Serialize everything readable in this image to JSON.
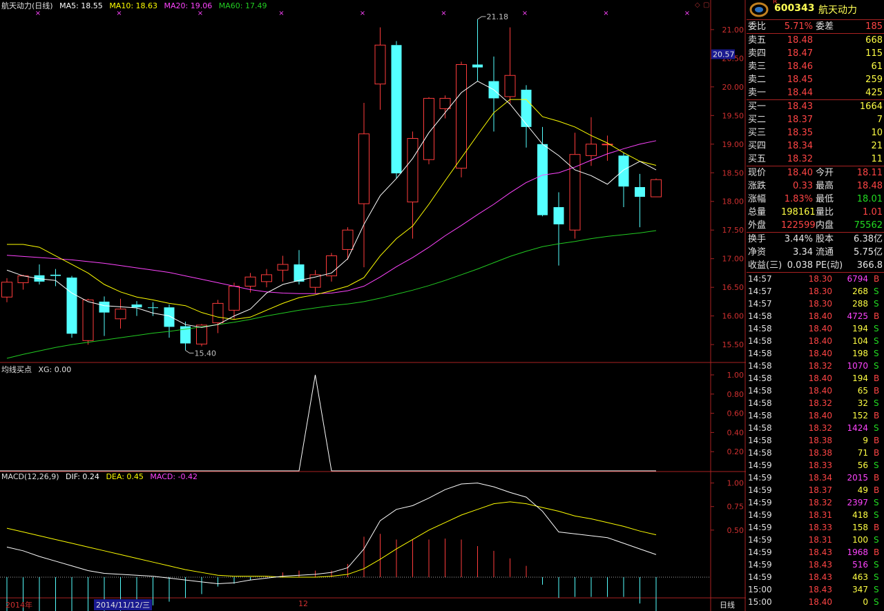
{
  "header": {
    "title": "航天动力(日线)",
    "ma": [
      {
        "label": "MA5: 18.55",
        "color": "#ffffff"
      },
      {
        "label": "MA10: 18.63",
        "color": "#ffff00"
      },
      {
        "label": "MA20: 19.06",
        "color": "#ff44ff"
      },
      {
        "label": "MA60: 17.49",
        "color": "#22cc22"
      }
    ]
  },
  "chart_data": {
    "type": "candlestick",
    "price_axis": {
      "ticks": [
        "21.00",
        "20.50",
        "20.00",
        "19.50",
        "19.00",
        "18.50",
        "18.00",
        "17.50",
        "17.00",
        "16.50",
        "16.00",
        "15.50"
      ],
      "range": [
        15.2,
        21.3
      ],
      "current_price_tag": "20.57"
    },
    "annotations": {
      "high_label": "21.18",
      "low_label": "15.40"
    },
    "candles": [
      {
        "o": 16.33,
        "c": 16.59,
        "h": 16.66,
        "l": 16.24
      },
      {
        "o": 16.58,
        "c": 16.7,
        "h": 16.72,
        "l": 16.46
      },
      {
        "o": 16.71,
        "c": 16.6,
        "h": 16.9,
        "l": 16.55
      },
      {
        "o": 16.72,
        "c": 16.7,
        "h": 16.82,
        "l": 16.52
      },
      {
        "o": 16.67,
        "c": 15.69,
        "h": 16.7,
        "l": 15.62
      },
      {
        "o": 15.57,
        "c": 16.28,
        "h": 16.3,
        "l": 15.5
      },
      {
        "o": 16.25,
        "c": 16.06,
        "h": 16.34,
        "l": 15.65
      },
      {
        "o": 15.95,
        "c": 16.12,
        "h": 16.3,
        "l": 15.78
      },
      {
        "o": 16.2,
        "c": 16.15,
        "h": 16.26,
        "l": 16.0
      },
      {
        "o": 16.15,
        "c": 16.14,
        "h": 16.24,
        "l": 16.0
      },
      {
        "o": 16.15,
        "c": 15.81,
        "h": 16.2,
        "l": 15.62
      },
      {
        "o": 15.82,
        "c": 15.52,
        "h": 15.9,
        "l": 15.4
      },
      {
        "o": 15.51,
        "c": 15.84,
        "h": 15.86,
        "l": 15.47
      },
      {
        "o": 15.88,
        "c": 16.22,
        "h": 16.28,
        "l": 15.7
      },
      {
        "o": 16.1,
        "c": 16.52,
        "h": 16.58,
        "l": 15.95
      },
      {
        "o": 16.52,
        "c": 16.68,
        "h": 16.75,
        "l": 16.41
      },
      {
        "o": 16.6,
        "c": 16.72,
        "h": 16.82,
        "l": 16.5
      },
      {
        "o": 16.8,
        "c": 16.9,
        "h": 17.05,
        "l": 16.6
      },
      {
        "o": 16.9,
        "c": 16.6,
        "h": 17.15,
        "l": 16.55
      },
      {
        "o": 16.5,
        "c": 16.72,
        "h": 16.8,
        "l": 16.4
      },
      {
        "o": 16.7,
        "c": 17.05,
        "h": 17.1,
        "l": 16.6
      },
      {
        "o": 17.16,
        "c": 17.5,
        "h": 17.55,
        "l": 16.98
      },
      {
        "o": 17.96,
        "c": 19.18,
        "h": 19.72,
        "l": 16.85
      },
      {
        "o": 20.05,
        "c": 20.73,
        "h": 21.04,
        "l": 19.6
      },
      {
        "o": 20.73,
        "c": 18.49,
        "h": 20.8,
        "l": 18.4
      },
      {
        "o": 17.99,
        "c": 19.1,
        "h": 19.22,
        "l": 17.35
      },
      {
        "o": 18.73,
        "c": 19.8,
        "h": 19.82,
        "l": 18.65
      },
      {
        "o": 19.62,
        "c": 19.8,
        "h": 19.85,
        "l": 19.45
      },
      {
        "o": 18.58,
        "c": 20.39,
        "h": 20.44,
        "l": 18.42
      },
      {
        "o": 20.39,
        "c": 20.34,
        "h": 21.18,
        "l": 20.1
      },
      {
        "o": 20.1,
        "c": 19.8,
        "h": 20.53,
        "l": 19.22
      },
      {
        "o": 19.83,
        "c": 20.2,
        "h": 21.04,
        "l": 19.7
      },
      {
        "o": 19.95,
        "c": 19.3,
        "h": 20.03,
        "l": 18.94
      },
      {
        "o": 19.0,
        "c": 17.76,
        "h": 19.3,
        "l": 17.74
      },
      {
        "o": 17.9,
        "c": 17.6,
        "h": 18.16,
        "l": 16.88
      },
      {
        "o": 17.5,
        "c": 18.82,
        "h": 19.2,
        "l": 17.35
      },
      {
        "o": 18.8,
        "c": 19.0,
        "h": 19.47,
        "l": 18.62
      },
      {
        "o": 19.0,
        "c": 19.0,
        "h": 19.15,
        "l": 18.71
      },
      {
        "o": 18.8,
        "c": 18.26,
        "h": 18.85,
        "l": 17.9
      },
      {
        "o": 18.25,
        "c": 18.08,
        "h": 18.48,
        "l": 17.55
      },
      {
        "o": 18.08,
        "c": 18.38,
        "h": 18.4,
        "l": 18.08
      }
    ],
    "ma5": [
      16.8,
      16.7,
      16.65,
      16.62,
      16.4,
      16.25,
      16.18,
      16.16,
      16.14,
      16.05,
      16.0,
      15.85,
      15.8,
      15.85,
      16.0,
      16.12,
      16.4,
      16.55,
      16.62,
      16.68,
      16.75,
      17.0,
      17.6,
      18.1,
      18.4,
      18.75,
      19.2,
      19.55,
      19.9,
      20.1,
      19.95,
      19.7,
      19.35,
      19.0,
      18.8,
      18.55,
      18.45,
      18.3,
      18.55,
      18.7,
      18.55
    ],
    "ma10": [
      17.25,
      17.25,
      17.2,
      17.05,
      16.9,
      16.75,
      16.55,
      16.42,
      16.33,
      16.28,
      16.22,
      16.18,
      16.06,
      15.98,
      15.94,
      15.98,
      16.1,
      16.22,
      16.32,
      16.37,
      16.44,
      16.52,
      16.67,
      17.05,
      17.35,
      17.57,
      17.95,
      18.36,
      18.76,
      19.16,
      19.55,
      19.78,
      19.78,
      19.48,
      19.4,
      19.3,
      19.15,
      19.02,
      18.85,
      18.7,
      18.63
    ],
    "ma20": [
      17.06,
      17.04,
      17.02,
      17.0,
      16.98,
      16.95,
      16.92,
      16.88,
      16.84,
      16.8,
      16.76,
      16.7,
      16.64,
      16.58,
      16.52,
      16.46,
      16.42,
      16.4,
      16.39,
      16.39,
      16.4,
      16.44,
      16.52,
      16.68,
      16.86,
      17.02,
      17.2,
      17.4,
      17.58,
      17.77,
      17.95,
      18.15,
      18.33,
      18.46,
      18.5,
      18.6,
      18.72,
      18.83,
      18.92,
      19.0,
      19.06
    ],
    "ma60": [
      15.26,
      15.33,
      15.39,
      15.45,
      15.5,
      15.54,
      15.58,
      15.62,
      15.66,
      15.7,
      15.73,
      15.77,
      15.81,
      15.85,
      15.89,
      15.94,
      16.0,
      16.05,
      16.1,
      16.14,
      16.18,
      16.21,
      16.25,
      16.31,
      16.38,
      16.45,
      16.53,
      16.62,
      16.72,
      16.82,
      16.93,
      17.04,
      17.13,
      17.21,
      17.26,
      17.3,
      17.35,
      17.39,
      17.42,
      17.45,
      17.49
    ],
    "xg_panel": {
      "title": "均线买点",
      "label": "XG: 0.00",
      "ticks": [
        "1.00",
        "0.80",
        "0.60",
        "0.40",
        "0.20"
      ],
      "values": [
        0,
        0,
        0,
        0,
        0,
        0,
        0,
        0,
        0,
        0,
        0,
        0,
        0,
        0,
        0,
        0,
        0,
        0,
        0,
        1,
        0,
        0,
        0,
        0,
        0,
        0,
        0,
        0,
        0,
        0,
        0,
        0,
        0,
        0,
        0,
        0,
        0,
        0,
        0,
        0,
        0
      ]
    },
    "macd_panel": {
      "title": "MACD(12,26,9)",
      "dif_label": "DIF: 0.24",
      "dea_label": "DEA: 0.45",
      "macd_label": "MACD: -0.42",
      "ticks": [
        "1.00",
        "0.75",
        "0.50"
      ],
      "range": [
        -0.22,
        1.1
      ],
      "dif": [
        0.32,
        0.28,
        0.22,
        0.17,
        0.12,
        0.07,
        0.04,
        0.03,
        0.02,
        0.01,
        -0.01,
        -0.03,
        -0.05,
        -0.07,
        -0.06,
        -0.03,
        -0.01,
        0.01,
        0.02,
        0.03,
        0.05,
        0.1,
        0.3,
        0.6,
        0.72,
        0.76,
        0.84,
        0.93,
        0.99,
        1.0,
        0.96,
        0.9,
        0.85,
        0.7,
        0.48,
        0.46,
        0.44,
        0.42,
        0.36,
        0.3,
        0.24
      ],
      "dea": [
        0.52,
        0.48,
        0.44,
        0.4,
        0.36,
        0.32,
        0.28,
        0.24,
        0.2,
        0.16,
        0.12,
        0.08,
        0.05,
        0.02,
        0.01,
        0.01,
        0.01,
        0.0,
        0.0,
        0.0,
        0.01,
        0.03,
        0.09,
        0.19,
        0.3,
        0.4,
        0.5,
        0.58,
        0.66,
        0.72,
        0.78,
        0.8,
        0.78,
        0.74,
        0.7,
        0.65,
        0.62,
        0.58,
        0.54,
        0.49,
        0.45
      ],
      "hist": [
        -0.41,
        -0.41,
        -0.41,
        -0.41,
        -0.41,
        -0.4,
        -0.39,
        -0.37,
        -0.35,
        -0.3,
        -0.26,
        -0.22,
        -0.18,
        -0.1,
        -0.07,
        -0.03,
        0.01,
        0.05,
        0.07,
        0.07,
        0.07,
        0.14,
        0.43,
        0.46,
        0.4,
        0.4,
        0.4,
        0.41,
        0.4,
        0.33,
        0.28,
        0.2,
        0.12,
        -0.08,
        -0.22,
        -0.21,
        -0.21,
        -0.21,
        -0.21,
        -0.28,
        -0.42
      ]
    }
  },
  "dates": {
    "year_label": "2014年",
    "cursor_date": "2014/11/12/三",
    "month_label": "12",
    "period_btn": "日线"
  },
  "quote": {
    "code": "600343",
    "name": "航天动力",
    "flag": "R",
    "webi": {
      "l1": "委比",
      "v1": "5.71%",
      "l2": "委差",
      "v2": "185"
    },
    "asks": [
      {
        "label": "卖五",
        "price": "18.48",
        "vol": "668"
      },
      {
        "label": "卖四",
        "price": "18.47",
        "vol": "115"
      },
      {
        "label": "卖三",
        "price": "18.46",
        "vol": "61"
      },
      {
        "label": "卖二",
        "price": "18.45",
        "vol": "259"
      },
      {
        "label": "卖一",
        "price": "18.44",
        "vol": "425"
      }
    ],
    "bids": [
      {
        "label": "买一",
        "price": "18.43",
        "vol": "1664"
      },
      {
        "label": "买二",
        "price": "18.37",
        "vol": "7"
      },
      {
        "label": "买三",
        "price": "18.35",
        "vol": "10"
      },
      {
        "label": "买四",
        "price": "18.34",
        "vol": "21"
      },
      {
        "label": "买五",
        "price": "18.32",
        "vol": "11"
      }
    ],
    "stats": [
      {
        "l1": "现价",
        "v1": "18.40",
        "c1": "red",
        "l2": "今开",
        "v2": "18.11",
        "c2": "red"
      },
      {
        "l1": "涨跌",
        "v1": "0.33",
        "c1": "red",
        "l2": "最高",
        "v2": "18.48",
        "c2": "red"
      },
      {
        "l1": "涨幅",
        "v1": "1.83%",
        "c1": "red",
        "l2": "最低",
        "v2": "18.01",
        "c2": "green"
      },
      {
        "l1": "总量",
        "v1": "198161",
        "c1": "yellow",
        "l2": "量比",
        "v2": "1.01",
        "c2": "red"
      },
      {
        "l1": "外盘",
        "v1": "122599",
        "c1": "red",
        "l2": "内盘",
        "v2": "75562",
        "c2": "green"
      }
    ],
    "fin": [
      {
        "l1": "换手",
        "v1": "3.44%",
        "l2": "股本",
        "v2": "6.38亿"
      },
      {
        "l1": "净资",
        "v1": "3.34",
        "l2": "流通",
        "v2": "5.75亿"
      },
      {
        "l1": "收益(三)",
        "v1": "0.038",
        "l2": "PE(动)",
        "v2": "366.8"
      }
    ],
    "ticks": [
      {
        "t": "14:57",
        "p": "18.30",
        "v": "6794",
        "s": "B",
        "vc": "mag"
      },
      {
        "t": "14:57",
        "p": "18.30",
        "v": "268",
        "s": "S",
        "vc": "yellow"
      },
      {
        "t": "14:57",
        "p": "18.30",
        "v": "288",
        "s": "S",
        "vc": "yellow"
      },
      {
        "t": "14:58",
        "p": "18.40",
        "v": "4725",
        "s": "B",
        "vc": "mag"
      },
      {
        "t": "14:58",
        "p": "18.40",
        "v": "194",
        "s": "S",
        "vc": "yellow"
      },
      {
        "t": "14:58",
        "p": "18.40",
        "v": "104",
        "s": "S",
        "vc": "yellow"
      },
      {
        "t": "14:58",
        "p": "18.40",
        "v": "198",
        "s": "S",
        "vc": "yellow"
      },
      {
        "t": "14:58",
        "p": "18.32",
        "v": "1070",
        "s": "S",
        "vc": "mag"
      },
      {
        "t": "14:58",
        "p": "18.40",
        "v": "194",
        "s": "B",
        "vc": "yellow"
      },
      {
        "t": "14:58",
        "p": "18.40",
        "v": "65",
        "s": "B",
        "vc": "yellow"
      },
      {
        "t": "14:58",
        "p": "18.32",
        "v": "32",
        "s": "S",
        "vc": "yellow"
      },
      {
        "t": "14:58",
        "p": "18.40",
        "v": "152",
        "s": "B",
        "vc": "yellow"
      },
      {
        "t": "14:58",
        "p": "18.32",
        "v": "1424",
        "s": "S",
        "vc": "mag"
      },
      {
        "t": "14:58",
        "p": "18.38",
        "v": "9",
        "s": "B",
        "vc": "yellow"
      },
      {
        "t": "14:58",
        "p": "18.38",
        "v": "71",
        "s": "B",
        "vc": "yellow"
      },
      {
        "t": "14:59",
        "p": "18.33",
        "v": "56",
        "s": "S",
        "vc": "yellow"
      },
      {
        "t": "14:59",
        "p": "18.34",
        "v": "2015",
        "s": "B",
        "vc": "mag"
      },
      {
        "t": "14:59",
        "p": "18.37",
        "v": "49",
        "s": "B",
        "vc": "yellow"
      },
      {
        "t": "14:59",
        "p": "18.32",
        "v": "2397",
        "s": "S",
        "vc": "mag"
      },
      {
        "t": "14:59",
        "p": "18.31",
        "v": "418",
        "s": "S",
        "vc": "yellow"
      },
      {
        "t": "14:59",
        "p": "18.33",
        "v": "158",
        "s": "B",
        "vc": "yellow"
      },
      {
        "t": "14:59",
        "p": "18.31",
        "v": "100",
        "s": "S",
        "vc": "yellow"
      },
      {
        "t": "14:59",
        "p": "18.43",
        "v": "1968",
        "s": "B",
        "vc": "mag"
      },
      {
        "t": "14:59",
        "p": "18.43",
        "v": "516",
        "s": "S",
        "vc": "mag"
      },
      {
        "t": "14:59",
        "p": "18.43",
        "v": "463",
        "s": "S",
        "vc": "yellow"
      },
      {
        "t": "15:00",
        "p": "18.43",
        "v": "347",
        "s": "S",
        "vc": "yellow"
      },
      {
        "t": "15:00",
        "p": "18.40",
        "v": "0",
        "s": "S",
        "vc": "yellow"
      }
    ]
  },
  "colors": {
    "up": "#ff3c3c",
    "down": "#54ffff",
    "ma5": "#ffffff",
    "ma10": "#ffff00",
    "ma20": "#ff44ff",
    "ma60": "#22cc22",
    "grid": "#aa2222",
    "dif": "#ffffff",
    "dea": "#ffff00"
  }
}
